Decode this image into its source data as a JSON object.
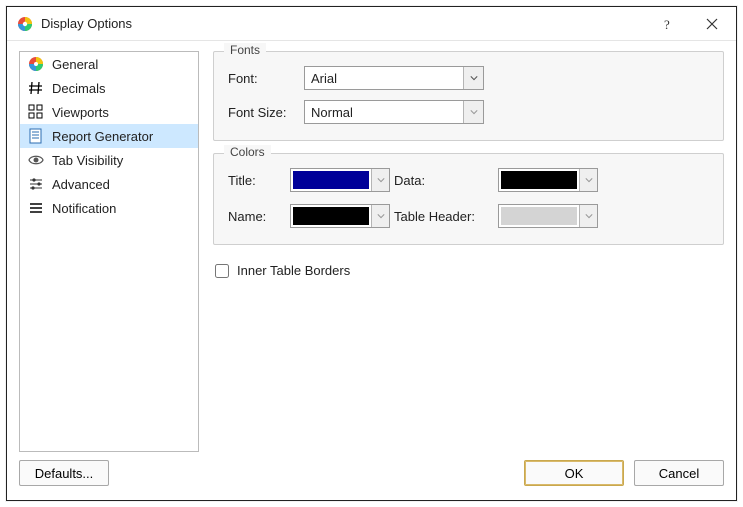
{
  "titlebar": {
    "title": "Display Options"
  },
  "sidebar": {
    "items": [
      {
        "icon": "color-wheel-icon",
        "label": "General"
      },
      {
        "icon": "hash-icon",
        "label": "Decimals"
      },
      {
        "icon": "viewports-icon",
        "label": "Viewports"
      },
      {
        "icon": "report-icon",
        "label": "Report Generator",
        "selected": true
      },
      {
        "icon": "eye-icon",
        "label": "Tab Visibility"
      },
      {
        "icon": "sliders-icon",
        "label": "Advanced"
      },
      {
        "icon": "list-icon",
        "label": "Notification"
      }
    ]
  },
  "fonts_group": {
    "legend": "Fonts",
    "font_label": "Font:",
    "font_value": "Arial",
    "size_label": "Font Size:",
    "size_value": "Normal"
  },
  "colors_group": {
    "legend": "Colors",
    "title_label": "Title:",
    "title_color": "#000099",
    "data_label": "Data:",
    "data_color": "#000000",
    "name_label": "Name:",
    "name_color": "#000000",
    "header_label": "Table Header:",
    "header_color": "#d4d4d4"
  },
  "inner_borders": {
    "label": "Inner Table Borders",
    "checked": false
  },
  "footer": {
    "defaults": "Defaults...",
    "ok": "OK",
    "cancel": "Cancel"
  }
}
